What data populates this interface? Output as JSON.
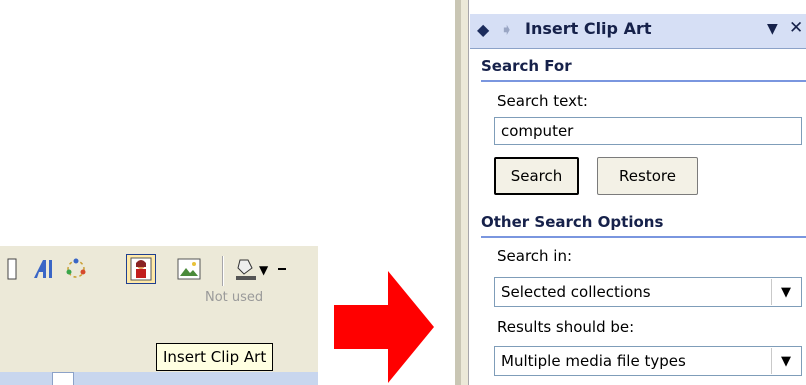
{
  "toolbar": {
    "tooltip": "Insert Clip Art",
    "faded_label": "Not used",
    "icons": [
      "frame-icon",
      "wordart-icon",
      "diagram-icon",
      "clip-art-icon",
      "picture-icon",
      "fill-color-icon"
    ]
  },
  "task_pane": {
    "title": "Insert Clip Art",
    "nav_back": "◆",
    "nav_forward": "➧",
    "menu_glyph": "▼",
    "close_glyph": "✕",
    "search_for": {
      "heading": "Search For",
      "search_text_label": "Search text:",
      "search_text_value": "computer",
      "search_button": "Search",
      "restore_button": "Restore"
    },
    "other_options": {
      "heading": "Other Search Options",
      "search_in_label": "Search in:",
      "search_in_value": "Selected collections",
      "results_label": "Results should be:",
      "results_value": "Multiple media file types"
    }
  },
  "colors": {
    "arrow": "#ff0000",
    "pane_header": "#d6dff5",
    "accent_rule": "#7a96df",
    "tooltip_bg": "#ffffe1"
  }
}
